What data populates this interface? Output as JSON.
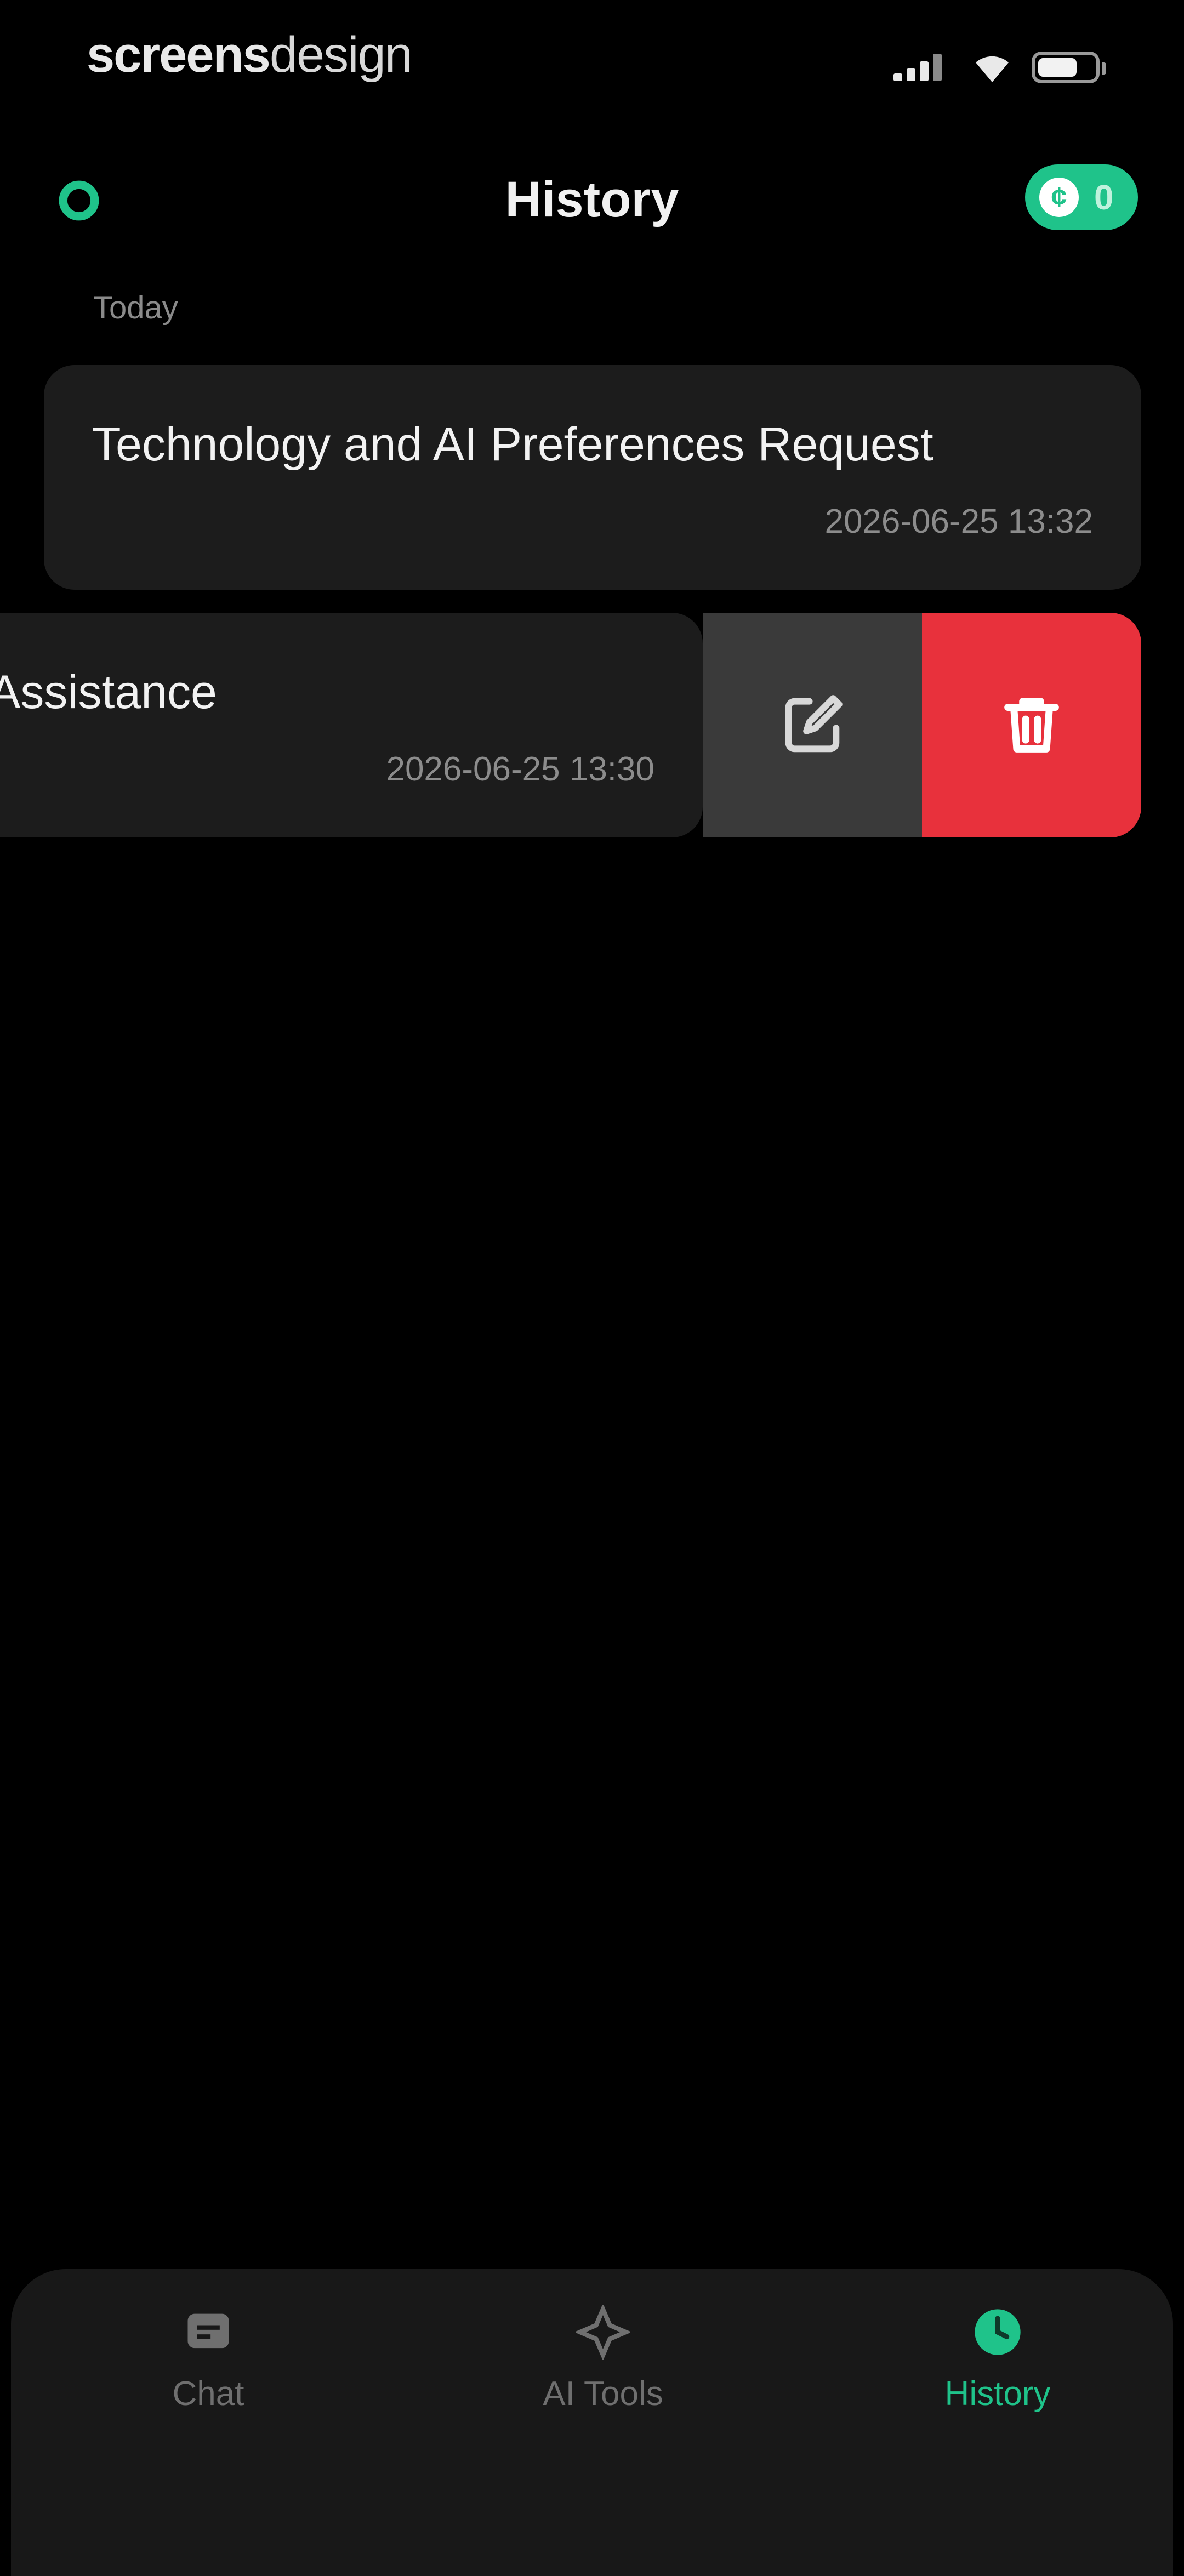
{
  "status_bar": {
    "brand_bold": "screens",
    "brand_light": "design"
  },
  "header": {
    "title": "History",
    "credits_symbol": "¢",
    "credits_count": "0"
  },
  "section_label": "Today",
  "conversations": [
    {
      "title": "Technology and AI Preferences Request",
      "timestamp": "2026-06-25 13:32"
    },
    {
      "title": "Assistance",
      "timestamp": "2026-06-25 13:30"
    }
  ],
  "tabs": [
    {
      "label": "Chat",
      "icon": "chat-icon",
      "active": false
    },
    {
      "label": "AI Tools",
      "icon": "ai-tools-icon",
      "active": false
    },
    {
      "label": "History",
      "icon": "history-icon",
      "active": true
    }
  ],
  "colors": {
    "accent": "#1fc38a",
    "delete": "#e8313c",
    "card": "#1c1c1c",
    "background": "#000000"
  }
}
